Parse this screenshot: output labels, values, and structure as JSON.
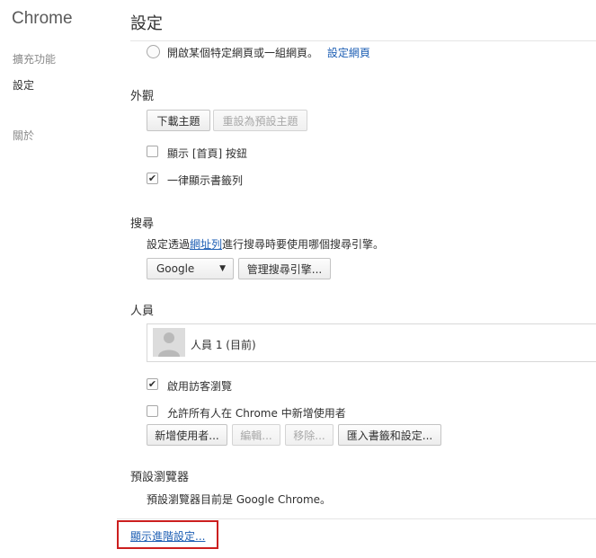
{
  "sidebar": {
    "brand": "Chrome",
    "items": [
      {
        "label": "擴充功能"
      },
      {
        "label": "設定"
      },
      {
        "label": "關於"
      }
    ]
  },
  "header": {
    "title": "設定"
  },
  "startup": {
    "radio_label": "開啟某個特定網頁或一組網頁。",
    "set_pages_link": "設定網頁"
  },
  "appearance": {
    "title": "外觀",
    "download_theme_button": "下載主題",
    "reset_theme_button": "重設為預設主題",
    "show_home_label": "顯示 [首頁] 按鈕",
    "show_bookmarks_label": "一律顯示書籤列"
  },
  "search": {
    "title": "搜尋",
    "desc_before": "設定透過",
    "desc_link": "網址列",
    "desc_after": "進行搜尋時要使用哪個搜尋引擎。",
    "engine_selected": "Google",
    "manage_button": "管理搜尋引擎..."
  },
  "people": {
    "title": "人員",
    "profile_name": "人員 1 (目前)",
    "guest_label": "啟用訪客瀏覽",
    "allow_add_label": "允許所有人在 Chrome 中新增使用者",
    "add_user_button": "新增使用者...",
    "edit_button": "編輯...",
    "remove_button": "移除...",
    "import_button": "匯入書籤和設定..."
  },
  "default_browser": {
    "title": "預設瀏覽器",
    "status": "預設瀏覽器目前是 Google Chrome。"
  },
  "advanced": {
    "link": "顯示進階設定..."
  },
  "colors": {
    "link": "#1e5fb4",
    "highlight_border": "#cc1f1f"
  }
}
